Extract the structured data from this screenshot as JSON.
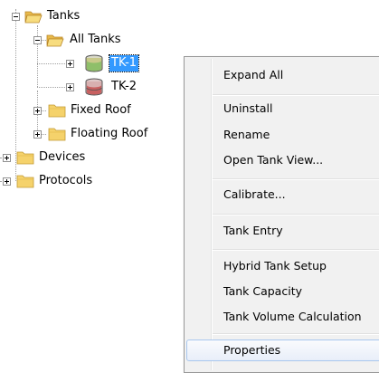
{
  "tree": {
    "nodes": {
      "tanks": "Tanks",
      "all_tanks": "All Tanks",
      "tk1": "TK-1",
      "tk2": "TK-2",
      "fixed_roof": "Fixed Roof",
      "floating_roof": "Floating Roof",
      "devices": "Devices",
      "protocols": "Protocols"
    },
    "selected": "TK-1"
  },
  "context_menu": {
    "items": [
      "Expand All",
      "Uninstall",
      "Rename",
      "Open Tank View...",
      "Calibrate...",
      "Tank Entry",
      "Hybrid Tank Setup",
      "Tank Capacity",
      "Tank Volume Calculation",
      "Properties"
    ],
    "highlighted": "Properties"
  },
  "colors": {
    "selection": "#3399ff",
    "folder": "#f5d26b",
    "menu_bg": "#f1f1f1"
  }
}
